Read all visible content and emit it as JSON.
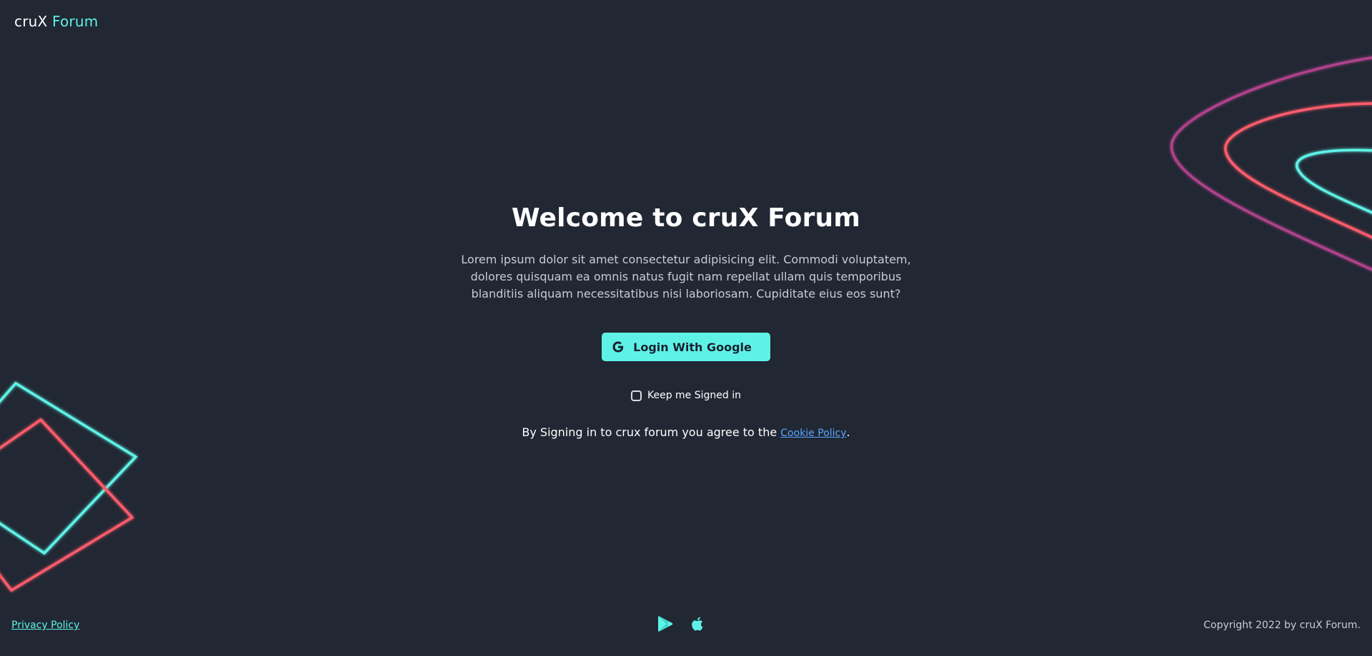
{
  "header": {
    "brand_prefix": "cruX",
    "brand_accent": "Forum"
  },
  "hero": {
    "title": "Welcome to cruX Forum",
    "description": "Lorem ipsum dolor sit amet consectetur adipisicing elit. Commodi voluptatem, dolores quisquam ea omnis natus fugit nam repellat ullam quis temporibus blanditiis aliquam necessitatibus nisi laboriosam. Cupiditate eius eos sunt?",
    "login_button_label": "Login With Google",
    "keep_signed_in_label": "Keep me Signed in",
    "keep_signed_in_checked": false,
    "agreement_text": "By Signing in to crux forum you agree to the ",
    "cookie_policy_link": "Cookie Policy",
    "agreement_suffix": "."
  },
  "footer": {
    "privacy_policy_link": "Privacy Policy",
    "store_icons": [
      "google-play-icon",
      "apple-icon"
    ],
    "copyright": "Copyright 2022 by cruX Forum."
  },
  "colors": {
    "background": "#212733",
    "accent": "#5ef2e6",
    "link": "#58a7ff",
    "decor_pink": "#ff5c6c",
    "decor_purple": "#b0428c"
  }
}
